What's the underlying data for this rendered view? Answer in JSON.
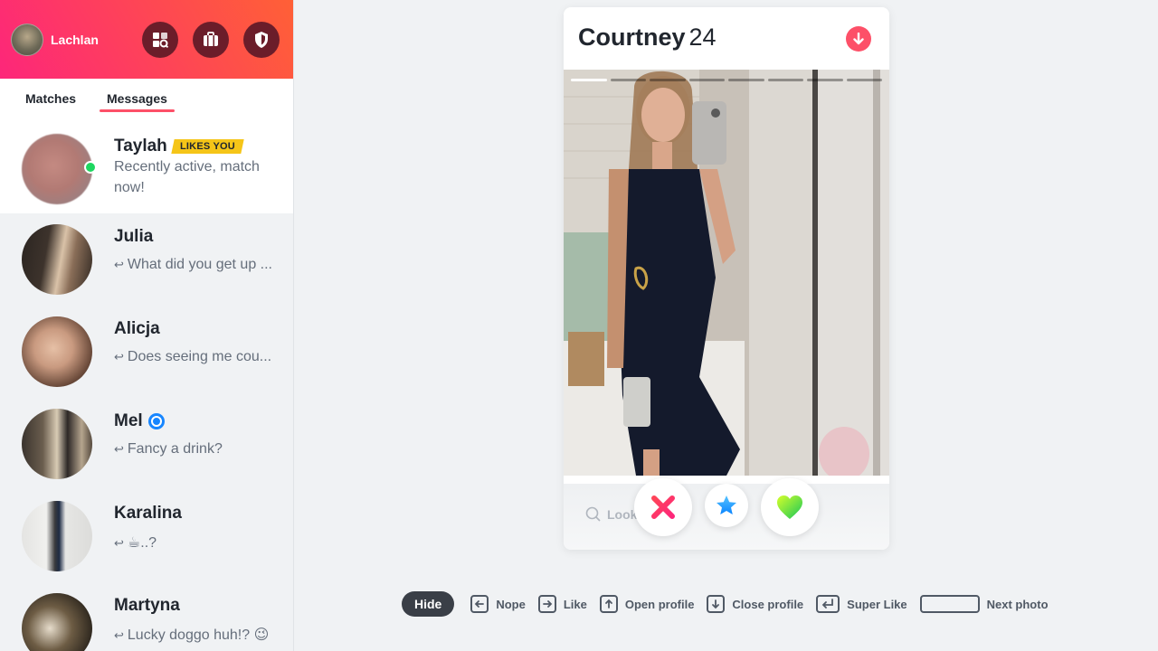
{
  "user": {
    "name": "Lachlan"
  },
  "tabs": [
    {
      "label": "Matches"
    },
    {
      "label": "Messages"
    }
  ],
  "messages": [
    {
      "name": "Taylah",
      "badge": "LIKES YOU",
      "text": "Recently active, match now!"
    },
    {
      "name": "Julia",
      "text": "What did you get up ..."
    },
    {
      "name": "Alicja",
      "text": "Does seeing me cou..."
    },
    {
      "name": "Mel",
      "text": "Fancy a drink?"
    },
    {
      "name": "Karalina",
      "text": "☕..?"
    },
    {
      "name": "Martyna",
      "text": "Lucky doggo huh!? 😉"
    }
  ],
  "card": {
    "name": "Courtney",
    "age": "24",
    "search_hint": "Look",
    "photo_count": 8,
    "active_photo": 1
  },
  "shortcuts": {
    "hide": "Hide",
    "items": [
      {
        "label": "Nope",
        "icon": "arrow-left-icon"
      },
      {
        "label": "Like",
        "icon": "arrow-right-icon"
      },
      {
        "label": "Open profile",
        "icon": "arrow-up-icon"
      },
      {
        "label": "Close profile",
        "icon": "arrow-down-icon"
      },
      {
        "label": "Super Like",
        "icon": "enter-icon"
      },
      {
        "label": "Next photo",
        "icon": "space-icon"
      }
    ]
  },
  "colors": {
    "brand_gradient_start": "#fd267a",
    "brand_gradient_end": "#ff6036",
    "accent": "#fd5068",
    "online": "#1ed760",
    "badge": "#f5c518",
    "verified": "#1786ff"
  }
}
